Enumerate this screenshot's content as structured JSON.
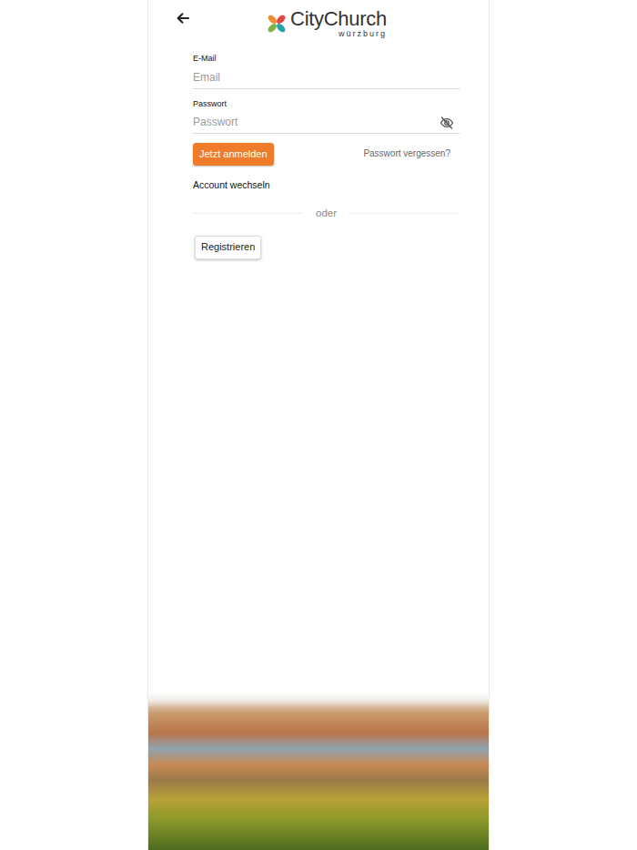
{
  "header": {
    "logo_name": "CityChurch",
    "logo_sub": "würzburg"
  },
  "form": {
    "fields": [
      {
        "label": "E-Mail",
        "placeholder": "Email",
        "kind": "email"
      },
      {
        "label": "Passwort",
        "placeholder": "Passwort",
        "kind": "password"
      }
    ],
    "password_visible": false,
    "login_button": "Jetzt anmelden",
    "forgot_link": "Passwort vergessen?",
    "switch_account": "Account wechseln",
    "divider": "oder",
    "register_button": "Registrieren"
  }
}
